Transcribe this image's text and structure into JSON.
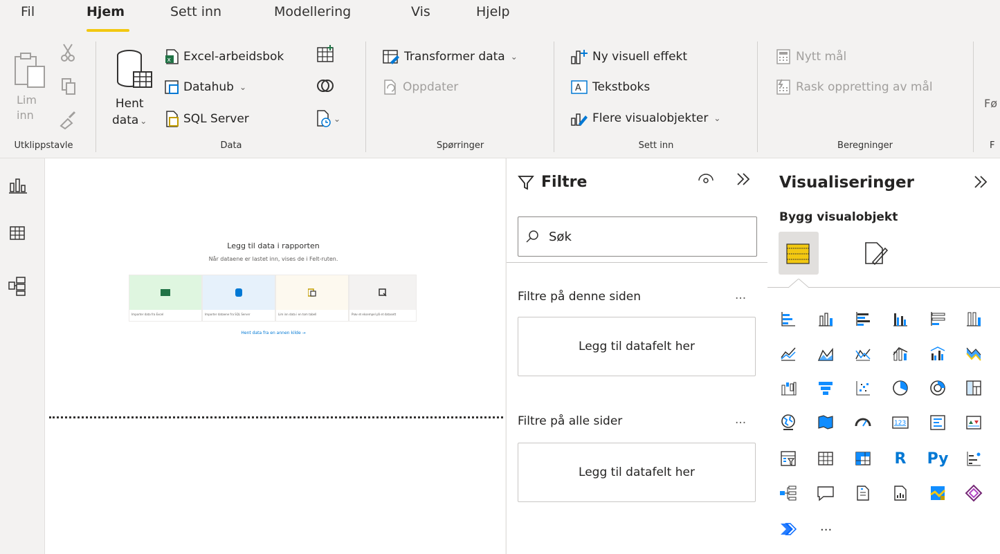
{
  "menu": {
    "items": [
      "Fil",
      "Hjem",
      "Sett inn",
      "Modellering",
      "Vis",
      "Hjelp"
    ],
    "active_index": 1
  },
  "ribbon": {
    "clipboard": {
      "paste_line1": "Lim",
      "paste_line2": "inn",
      "label": "Utklippstavle"
    },
    "data": {
      "get_data_line1": "Hent",
      "get_data_line2": "data",
      "excel": "Excel-arbeidsbok",
      "datahub": "Datahub",
      "sql": "SQL Server",
      "label": "Data"
    },
    "queries": {
      "transform": "Transformer data",
      "refresh": "Oppdater",
      "label": "Spørringer"
    },
    "insert": {
      "new_visual": "Ny visuell effekt",
      "textbox": "Tekstboks",
      "more_visuals": "Flere visualobjekter",
      "label": "Sett inn"
    },
    "calculations": {
      "new_measure": "Nytt mål",
      "quick_measure": "Rask oppretting av mål",
      "label": "Beregninger"
    },
    "cut_label": "Fø",
    "cut_group_label": "F"
  },
  "canvas": {
    "title": "Legg til data i rapporten",
    "subtitle": "Når dataene er lastet inn, vises de i Felt-ruten.",
    "cards": [
      {
        "caption": "Importer data fra Excel",
        "color": "#dff6e0",
        "icon_color": "#217346"
      },
      {
        "caption": "Importer dataene fra SQL Server",
        "color": "#e6f1fb",
        "icon_color": "#0078d4"
      },
      {
        "caption": "Lim inn data i en tom tabell",
        "color": "#fdf9ef",
        "icon_color": "#c19c00"
      },
      {
        "caption": "Prøv et eksempel på et datasett",
        "color": "#f3f2f1",
        "icon_color": "#323130"
      }
    ],
    "other_source_link": "Hent data fra en annen kilde →"
  },
  "filters": {
    "title": "Filtre",
    "search_placeholder": "Søk",
    "page_section": "Filtre på denne siden",
    "page_drop": "Legg til datafelt her",
    "all_section": "Filtre på alle sider",
    "all_drop": "Legg til datafelt her",
    "more": "..."
  },
  "viz": {
    "title": "Visualiseringer",
    "subtitle": "Bygg visualobjekt",
    "r_label": "R",
    "py_label": "Py",
    "more": "..."
  }
}
